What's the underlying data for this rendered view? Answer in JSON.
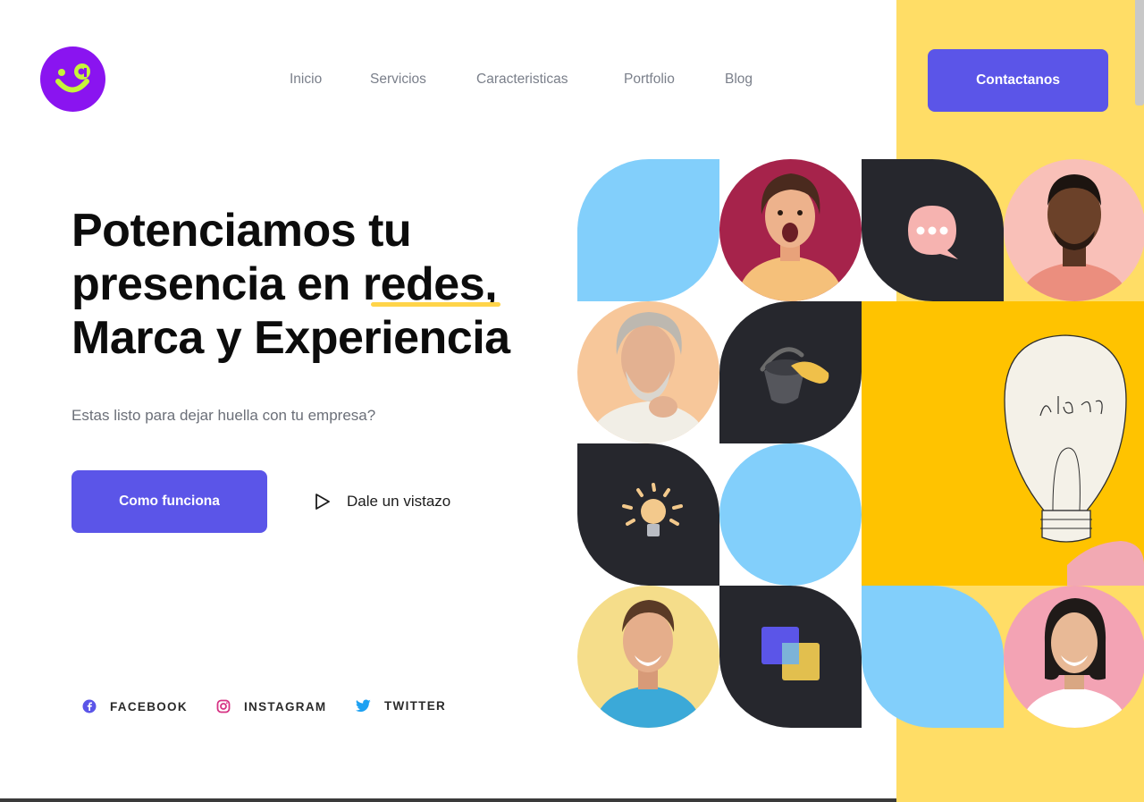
{
  "nav": {
    "items": [
      "Inicio",
      "Servicios",
      "Caracteristicas",
      "Portfolio",
      "Blog"
    ],
    "contact_label": "Contactanos"
  },
  "hero": {
    "title_line1": "Potenciamos tu",
    "title_line2_a": "presencia en ",
    "title_line2_highlight": "redes",
    "title_line2_b": ",",
    "title_line3": "Marca y Experiencia",
    "subtitle": "Estas listo para dejar huella con tu empresa?",
    "cta_label": "Como funciona",
    "video_label": "Dale un vistazo"
  },
  "socials": [
    {
      "label": "FACEBOOK",
      "icon": "facebook-icon",
      "color": "#5B55E8"
    },
    {
      "label": "INSTAGRAM",
      "icon": "instagram-icon",
      "color": "#D63384"
    },
    {
      "label": "TWITTER",
      "icon": "twitter-icon",
      "color": "#1DA1F2"
    }
  ],
  "colors": {
    "brand_purple": "#5B55E8",
    "logo_purple": "#8A14F0",
    "logo_accent": "#C6F53A",
    "yellow_band": "#FFDD66",
    "yellow_tile": "#FFC300",
    "dark_tile": "#26272D",
    "blue_tile": "#82CFFB",
    "highlight_underline": "#FFD449"
  },
  "gallery": {
    "tiles": [
      "blue-leaf-shape",
      "photo-surprised-woman",
      "chat-bubble-icon",
      "photo-man-portrait",
      "photo-bearded-senior-man",
      "paint-bucket-icon",
      "lightbulb-icon",
      "blue-circle-shape",
      "photo-smiling-man",
      "layers-icon",
      "blue-leaf-shape",
      "photo-smiling-woman",
      "idea-lightbulb-drawing"
    ]
  }
}
